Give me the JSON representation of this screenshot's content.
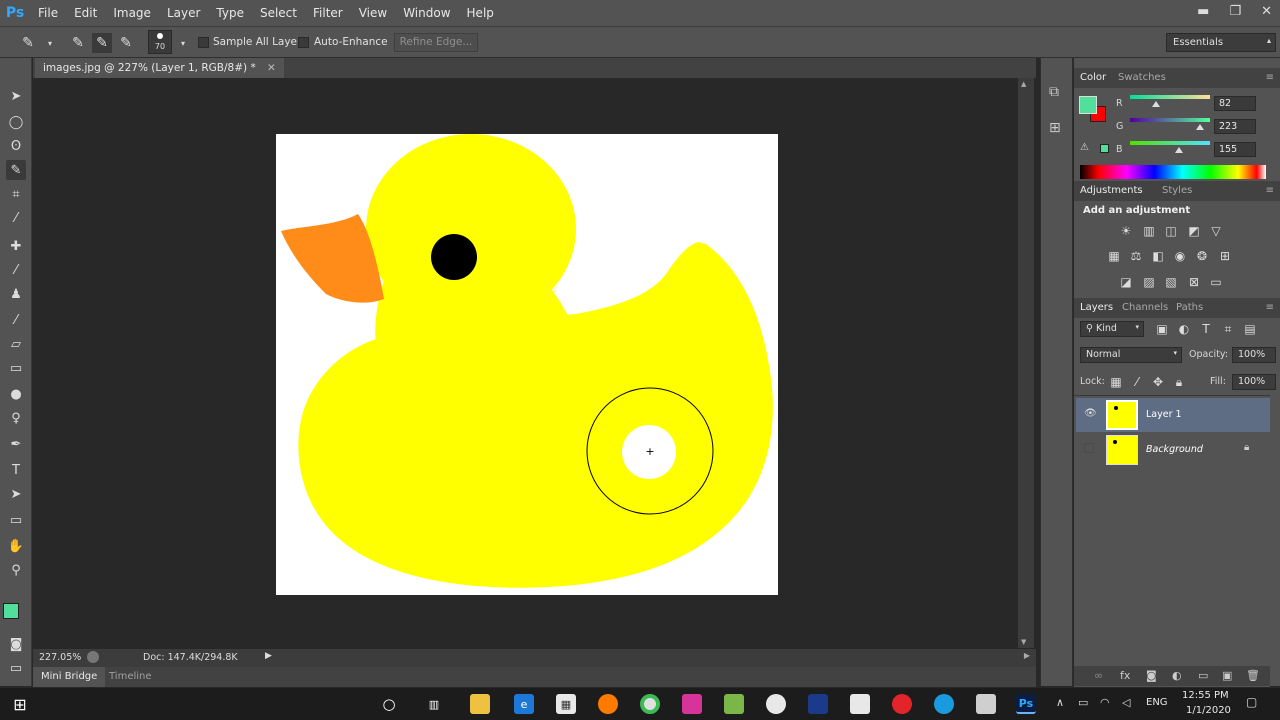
{
  "app": {
    "logo": "Ps"
  },
  "menu": [
    "File",
    "Edit",
    "Image",
    "Layer",
    "Type",
    "Select",
    "Filter",
    "View",
    "Window",
    "Help"
  ],
  "window_controls": {
    "minimize": "▬",
    "restore": "❐",
    "close": "✕"
  },
  "options": {
    "brush_size": "70",
    "sample_all_layers": "Sample All Layers",
    "auto_enhance": "Auto-Enhance",
    "refine_edge": "Refine Edge...",
    "workspace": "Essentials"
  },
  "document": {
    "tab_title": "images.jpg @ 227% (Layer 1, RGB/8#) *",
    "zoom": "227.05%",
    "doc_size": "Doc: 147.4K/294.8K"
  },
  "bottom_tabs": [
    "Mini Bridge",
    "Timeline"
  ],
  "color_panel": {
    "tabs": [
      "Color",
      "Swatches"
    ],
    "channels": [
      {
        "label": "R",
        "value": "82"
      },
      {
        "label": "G",
        "value": "223"
      },
      {
        "label": "B",
        "value": "155"
      }
    ],
    "foreground": "#52df9b",
    "background": "#ff0000"
  },
  "adjustments_panel": {
    "tabs": [
      "Adjustments",
      "Styles"
    ],
    "heading": "Add an adjustment"
  },
  "layers_panel": {
    "tabs": [
      "Layers",
      "Channels",
      "Paths"
    ],
    "filter_kind": "Kind",
    "blend_mode": "Normal",
    "opacity_label": "Opacity:",
    "opacity": "100%",
    "lock_label": "Lock:",
    "fill_label": "Fill:",
    "fill": "100%",
    "layers": [
      {
        "name": "Layer 1"
      },
      {
        "name": "Background"
      }
    ]
  },
  "taskbar": {
    "language": "ENG",
    "time": "12:55 PM",
    "date": "1/1/2020"
  },
  "colors": {
    "duck_yellow": "#ffff00",
    "beak_orange": "#ff8b18",
    "ps_blue": "#31a8ff"
  }
}
